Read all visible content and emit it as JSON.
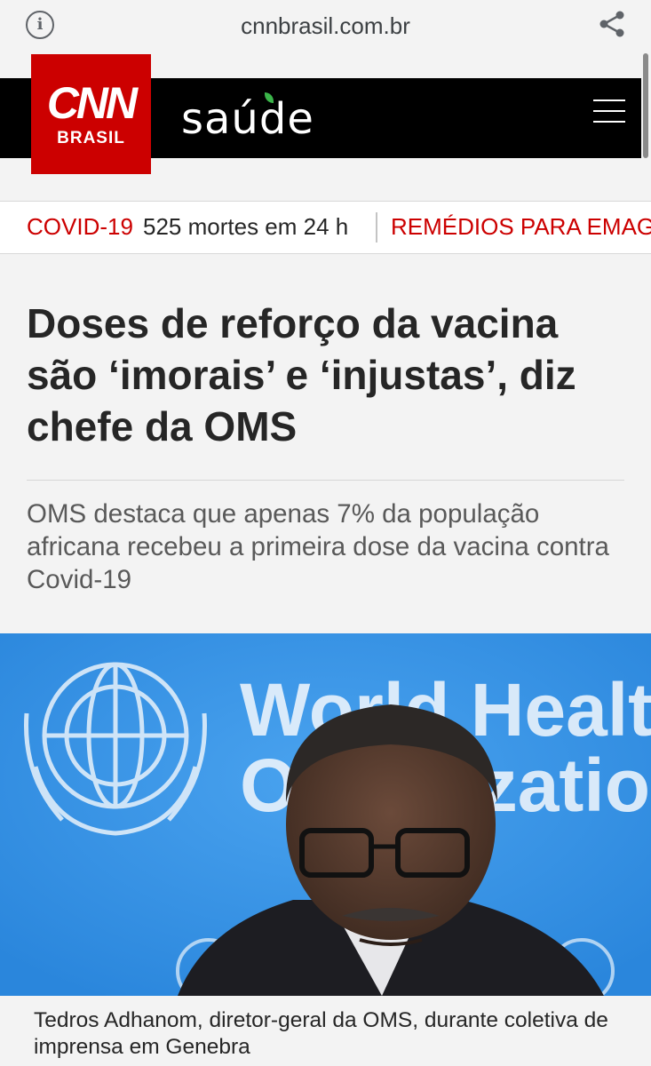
{
  "browser": {
    "url": "cnnbrasil.com.br",
    "info_icon": "info-icon",
    "share_icon": "share-icon"
  },
  "header": {
    "logo_line1": "CNN",
    "logo_line2": "BRASIL",
    "section": "saúde",
    "menu_icon": "hamburger-menu-icon",
    "background": "#000000",
    "logo_color": "#cc0000"
  },
  "ticker": {
    "topic1": "COVID-19",
    "topic1_detail": "525 mortes em 24 h",
    "topic2": "REMÉDIOS PARA EMAGR",
    "accent": "#cc0000"
  },
  "article": {
    "headline": "Doses de reforço da vacina são ‘imorais’ e ‘injustas’, diz chefe da OMS",
    "subhead": "OMS destaca que apenas 7% da população africana recebeu a primeira dose da vacina contra Covid-19",
    "photo_banner_line1": "World Health",
    "photo_banner_line2": "Organization",
    "caption": "Tedros Adhanom, diretor-geral da OMS, durante coletiva de imprensa em Genebra"
  }
}
